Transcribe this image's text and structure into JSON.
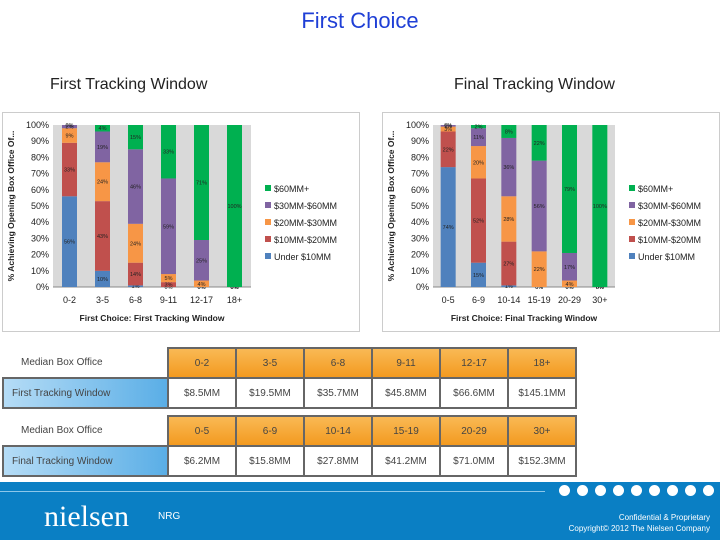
{
  "title": "First Choice",
  "colors": {
    "under10": "#4f81bd",
    "10to20": "#c0504d",
    "20to30": "#f79646",
    "30to60": "#8064a2",
    "60plus": "#00b050",
    "plot_bg": "#d9d9d9"
  },
  "chart_data": [
    {
      "type": "bar",
      "stacked": true,
      "subtitle": "First Tracking Window",
      "xlabel": "First Choice: First Tracking Window",
      "ylabel": "% Achieving Opening Box Office Of...",
      "ylim": [
        0,
        100
      ],
      "yticks": [
        "0%",
        "10%",
        "20%",
        "30%",
        "40%",
        "50%",
        "60%",
        "70%",
        "80%",
        "90%",
        "100%"
      ],
      "legend": "right",
      "categories": [
        "0-2",
        "3-5",
        "6-8",
        "9-11",
        "12-17",
        "18+"
      ],
      "series": [
        {
          "name": "Under $10MM",
          "key": "under10",
          "values": [
            56,
            10,
            1,
            0,
            0,
            0
          ]
        },
        {
          "name": "$10MM-$20MM",
          "key": "10to20",
          "values": [
            33,
            43,
            14,
            3,
            0,
            0
          ]
        },
        {
          "name": "$20MM-$30MM",
          "key": "20to30",
          "values": [
            9,
            24,
            24,
            5,
            4,
            0
          ]
        },
        {
          "name": "$30MM-$60MM",
          "key": "30to60",
          "values": [
            2,
            19,
            46,
            59,
            25,
            0
          ]
        },
        {
          "name": "$60MM+",
          "key": "60plus",
          "values": [
            0,
            4,
            15,
            33,
            71,
            100
          ]
        }
      ]
    },
    {
      "type": "bar",
      "stacked": true,
      "subtitle": "Final Tracking Window",
      "xlabel": "First Choice: Final Tracking Window",
      "ylabel": "% Achieving Opening Box Office Of...",
      "ylim": [
        0,
        100
      ],
      "yticks": [
        "0%",
        "10%",
        "20%",
        "30%",
        "40%",
        "50%",
        "60%",
        "70%",
        "80%",
        "90%",
        "100%"
      ],
      "legend": "right",
      "categories": [
        "0-5",
        "6-9",
        "10-14",
        "15-19",
        "20-29",
        "30+"
      ],
      "series": [
        {
          "name": "Under $10MM",
          "key": "under10",
          "values": [
            74,
            15,
            1,
            0,
            0,
            0
          ]
        },
        {
          "name": "$10MM-$20MM",
          "key": "10to20",
          "values": [
            22,
            52,
            27,
            0,
            0,
            0
          ]
        },
        {
          "name": "$20MM-$30MM",
          "key": "20to30",
          "values": [
            3,
            20,
            28,
            22,
            4,
            0
          ]
        },
        {
          "name": "$30MM-$60MM",
          "key": "30to60",
          "values": [
            1,
            11,
            36,
            56,
            17,
            0
          ]
        },
        {
          "name": "$60MM+",
          "key": "60plus",
          "values": [
            0,
            2,
            8,
            22,
            79,
            100
          ]
        }
      ]
    }
  ],
  "tables": [
    {
      "label": "Median Box Office",
      "row_label": "First Tracking Window",
      "headers": [
        "0-2",
        "3-5",
        "6-8",
        "9-11",
        "12-17",
        "18+"
      ],
      "values": [
        "$8.5MM",
        "$19.5MM",
        "$35.7MM",
        "$45.8MM",
        "$66.6MM",
        "$145.1MM"
      ]
    },
    {
      "label": "Median Box Office",
      "row_label": "Final Tracking Window",
      "headers": [
        "0-5",
        "6-9",
        "10-14",
        "15-19",
        "20-29",
        "30+"
      ],
      "values": [
        "$6.2MM",
        "$15.8MM",
        "$27.8MM",
        "$41.2MM",
        "$71.0MM",
        "$152.3MM"
      ]
    }
  ],
  "footer": {
    "logo": "nielsen",
    "org": "NRG",
    "confidential": "Confidential & Proprietary",
    "copyright": "Copyright© 2012 The Nielsen Company"
  }
}
